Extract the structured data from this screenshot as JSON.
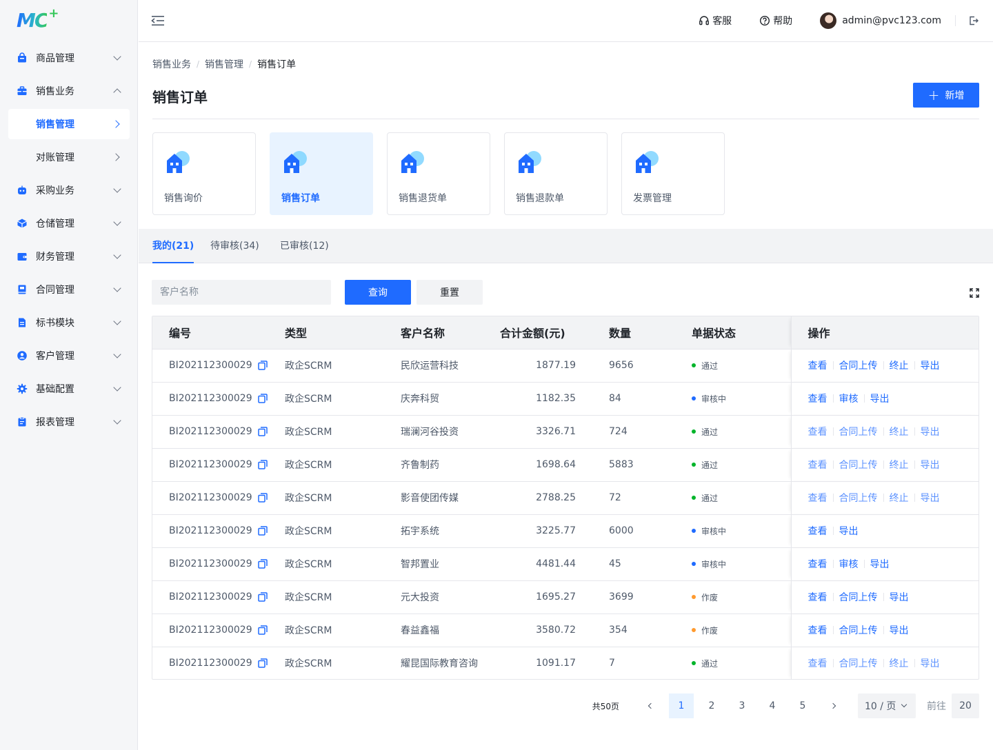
{
  "brand": {
    "logo_text": "MC",
    "logo_plus": "+"
  },
  "sidebar": {
    "items": [
      {
        "key": "goods",
        "label": "商品管理",
        "icon": "bag-icon",
        "state": "collapsed"
      },
      {
        "key": "sales",
        "label": "销售业务",
        "icon": "briefcase-icon",
        "state": "expanded",
        "children": [
          {
            "label": "销售管理",
            "active": true
          },
          {
            "label": "对账管理",
            "active": false
          }
        ]
      },
      {
        "key": "purchase",
        "label": "采购业务",
        "icon": "robot-icon",
        "state": "collapsed"
      },
      {
        "key": "warehouse",
        "label": "仓储管理",
        "icon": "cube-icon",
        "state": "collapsed"
      },
      {
        "key": "finance",
        "label": "财务管理",
        "icon": "wallet-icon",
        "state": "collapsed"
      },
      {
        "key": "contract",
        "label": "合同管理",
        "icon": "book-icon",
        "state": "collapsed"
      },
      {
        "key": "bid",
        "label": "标书模块",
        "icon": "file-icon",
        "state": "collapsed"
      },
      {
        "key": "customer",
        "label": "客户管理",
        "icon": "user-circle-icon",
        "state": "collapsed"
      },
      {
        "key": "config",
        "label": "基础配置",
        "icon": "gear-icon",
        "state": "collapsed"
      },
      {
        "key": "report",
        "label": "报表管理",
        "icon": "clipboard-icon",
        "state": "collapsed"
      }
    ]
  },
  "topbar": {
    "service_label": "客服",
    "help_label": "帮助",
    "user_email": "admin@pvc123.com"
  },
  "breadcrumb": [
    "销售业务",
    "销售管理",
    "销售订单"
  ],
  "page": {
    "title": "销售订单",
    "add_label": "新增"
  },
  "cards": [
    {
      "label": "销售询价",
      "active": false
    },
    {
      "label": "销售订单",
      "active": true
    },
    {
      "label": "销售退货单",
      "active": false
    },
    {
      "label": "销售退款单",
      "active": false
    },
    {
      "label": "发票管理",
      "active": false
    }
  ],
  "tabs": [
    {
      "label": "我的(21)",
      "active": true
    },
    {
      "label": "待审核(34)",
      "active": false
    },
    {
      "label": "已审核(12)",
      "active": false
    }
  ],
  "filters": {
    "customer_placeholder": "客户名称",
    "query_label": "查询",
    "reset_label": "重置"
  },
  "table": {
    "columns": [
      "编号",
      "类型",
      "客户名称",
      "合计金额(元)",
      "数量",
      "单据状态",
      "操作"
    ],
    "rows": [
      {
        "code": "BI202112300029",
        "type": "政企SCRM",
        "customer": "民欣运营科技",
        "amount": "1877.19",
        "qty": "9656",
        "status": "通过",
        "ops": [
          "查看",
          "合同上传",
          "终止",
          "导出"
        ]
      },
      {
        "code": "BI202112300029",
        "type": "政企SCRM",
        "customer": "庆奔科贸",
        "amount": "1182.35",
        "qty": "84",
        "status": "审核中",
        "ops": [
          "查看",
          "审核",
          "导出"
        ]
      },
      {
        "code": "BI202112300029",
        "type": "政企SCRM",
        "customer": "瑞澜河谷投资",
        "amount": "3326.71",
        "qty": "724",
        "status": "通过",
        "ops": [
          "查看",
          "合同上传",
          "终止",
          "导出"
        ]
      },
      {
        "code": "BI202112300029",
        "type": "政企SCRM",
        "customer": "齐鲁制药",
        "amount": "1698.64",
        "qty": "5883",
        "status": "通过",
        "ops": [
          "查看",
          "合同上传",
          "终止",
          "导出"
        ]
      },
      {
        "code": "BI202112300029",
        "type": "政企SCRM",
        "customer": "影音使团传媒",
        "amount": "2788.25",
        "qty": "72",
        "status": "通过",
        "ops": [
          "查看",
          "合同上传",
          "终止",
          "导出"
        ]
      },
      {
        "code": "BI202112300029",
        "type": "政企SCRM",
        "customer": "拓宇系统",
        "amount": "3225.77",
        "qty": "6000",
        "status": "审核中",
        "ops": [
          "查看",
          "导出"
        ]
      },
      {
        "code": "BI202112300029",
        "type": "政企SCRM",
        "customer": "智邦置业",
        "amount": "4481.44",
        "qty": "45",
        "status": "审核中",
        "ops": [
          "查看",
          "审核",
          "导出"
        ]
      },
      {
        "code": "BI202112300029",
        "type": "政企SCRM",
        "customer": "元大投资",
        "amount": "1695.27",
        "qty": "3699",
        "status": "作废",
        "ops": [
          "查看",
          "合同上传",
          "导出"
        ]
      },
      {
        "code": "BI202112300029",
        "type": "政企SCRM",
        "customer": "春益鑫福",
        "amount": "3580.72",
        "qty": "354",
        "status": "作废",
        "ops": [
          "查看",
          "合同上传",
          "导出"
        ]
      },
      {
        "code": "BI202112300029",
        "type": "政企SCRM",
        "customer": "耀昆国际教育咨询",
        "amount": "1091.17",
        "qty": "7",
        "status": "通过",
        "ops": [
          "查看",
          "合同上传",
          "终止",
          "导出"
        ]
      }
    ]
  },
  "status_colors": {
    "通过": "#00b42a",
    "审核中": "#1f6bff",
    "作废": "#ff9a2e"
  },
  "pagination": {
    "total_label": "共50页",
    "pages": [
      "1",
      "2",
      "3",
      "4",
      "5"
    ],
    "current": "1",
    "page_size_label": "10 / 页",
    "goto_label": "前往",
    "goto_value": "20"
  },
  "colors": {
    "primary": "#1f6bff",
    "sidebar_bg": "#f5f6f8"
  }
}
